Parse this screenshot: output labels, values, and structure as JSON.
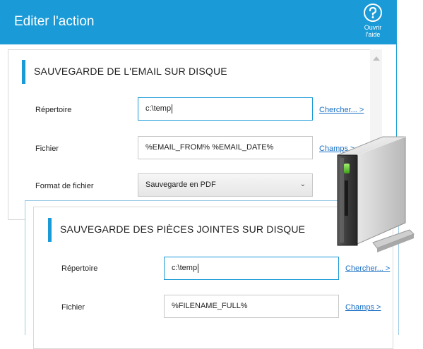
{
  "window": {
    "title": "Editer l'action",
    "help_label_1": "Ouvrir",
    "help_label_2": "l'aide"
  },
  "email_section": {
    "title": "SAUVEGARDE DE L'EMAIL SUR DISQUE",
    "directory_label": "Répertoire",
    "directory_value": "c:\\temp",
    "browse_link": "Chercher... >",
    "file_label": "Fichier",
    "file_value": "%EMAIL_FROM% %EMAIL_DATE%",
    "fields_link": "Champs >",
    "format_label": "Format de fichier",
    "format_value": "Sauvegarde en PDF"
  },
  "attachments_section": {
    "title": "SAUVEGARDE DES PIÈCES JOINTES SUR DISQUE",
    "directory_label": "Répertoire",
    "directory_value": "c:\\temp",
    "browse_link": "Chercher... >",
    "file_label": "Fichier",
    "file_value": "%FILENAME_FULL%",
    "fields_link": "Champs >"
  },
  "colors": {
    "accent": "#1a9ad6",
    "link": "#1a6fc4"
  },
  "icons": {
    "help": "help-icon",
    "select_arrow": "chevron-down-icon",
    "drive": "external-drive-icon"
  }
}
